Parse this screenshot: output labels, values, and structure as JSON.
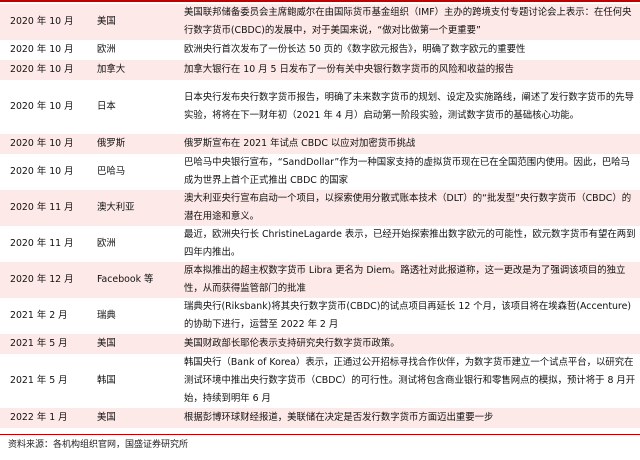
{
  "rows": [
    {
      "date": "2020 年 10 月",
      "region": "美国",
      "event": "美国联邦储备委员会主席鲍威尔在由国际货币基金组织（IMF）主办的跨境支付专题讨论会上表示：在任何央行数字货币(CBDC)的发展中，对于美国来说，“做对比做第一个更重要”"
    },
    {
      "date": "2020 年 10 月",
      "region": "欧洲",
      "event": "欧洲央行首次发布了一份长达 50 页的《数字欧元报告》，明确了数字欧元的重要性"
    },
    {
      "date": "2020 年 10 月",
      "region": "加拿大",
      "event": "加拿大银行在 10 月 5 日发布了一份有关中央银行数字货币的风险和收益的报告"
    },
    {
      "date": "2020 年 10 月",
      "region": "日本",
      "event": "日本央行发布央行数字货币报告，明确了未来数字货币的规划、设定及实施路线，阐述了发行数字货币的先导实验，将将在下一财年初（2021 年 4 月）启动第一阶段实验，测试数字货币的基础核心功能。"
    },
    {
      "date": "2020 年 10 月",
      "region": "俄罗斯",
      "event": "俄罗斯宣布在 2021 年试点 CBDC 以应对加密货币挑战"
    },
    {
      "date": "2020 年 10 月",
      "region": "巴哈马",
      "event": "巴哈马中央银行宣布，“SandDollar”作为一种国家支持的虚拟货币现在已在全国范围内使用。因此，巴哈马成为世界上首个正式推出 CBDC 的国家"
    },
    {
      "date": "2020 年 11 月",
      "region": "澳大利亚",
      "event": "澳大利亚央行宣布启动一个项目，以探索使用分散式账本技术（DLT）的“批发型”央行数字货币（CBDC）的潜在用途和意义。"
    },
    {
      "date": "2020 年 11 月",
      "region": "欧洲",
      "event": "最近，欧洲央行长 ChristineLagarde 表示，已经开始探索推出数字欧元的可能性，欧元数字货币有望在两到四年内推出。"
    },
    {
      "date": "2020 年 12 月",
      "region": "Facebook 等",
      "event": "原本拟推出的超主权数字货币 Libra 更名为 Diem。路透社对此报道称，这一更改是为了强调该项目的独立性，从而获得监管部门的批准"
    },
    {
      "date": "2021 年 2 月",
      "region": "瑞典",
      "event": "瑞典央行(Riksbank)将其央行数字货币(CBDC)的试点项目再延长 12 个月，该项目将在埃森哲(Accenture)的协助下进行，运营至 2022 年 2 月"
    },
    {
      "date": "2021 年 5 月",
      "region": "美国",
      "event": "美国财政部长耶伦表示支持研究央行数字货币政策。"
    },
    {
      "date": "2021 年 5 月",
      "region": "韩国",
      "event": "韩国央行（Bank of Korea）表示，正通过公开招标寻找合作伙伴，为数字货币建立一个试点平台，以研究在测试环境中推出央行数字货币（CBDC）的可行性。测试将包含商业银行和零售网点的模拟，预计将于 8 月开始，持续到明年 6 月"
    },
    {
      "date": "2022 年 1 月",
      "region": "美国",
      "event": "根据彭博环球财经报道，美联储在决定是否发行数字货币方面迈出重要一步"
    }
  ],
  "source": "资料来源：各机构组织官网，国盛证券研究所",
  "colors": {
    "accent": "#c00000",
    "shade": "#fde9e7"
  }
}
